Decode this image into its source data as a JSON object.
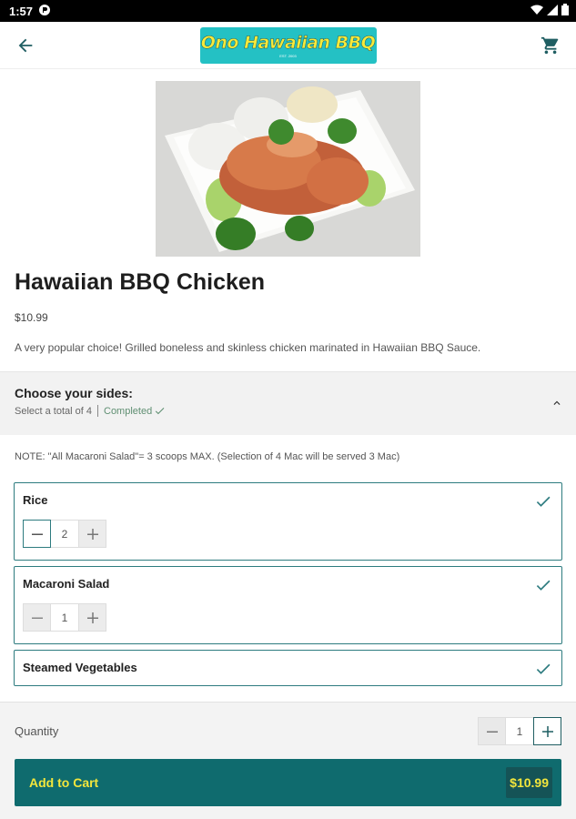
{
  "status_bar": {
    "time": "1:57"
  },
  "header": {
    "logo_text": "Ono Hawaiian BBQ",
    "logo_sub": "EST. 2003"
  },
  "item": {
    "title": "Hawaiian BBQ Chicken",
    "price": "$10.99",
    "description": "A very popular choice! Grilled boneless and skinless chicken marinated in Hawaiian BBQ Sauce."
  },
  "sides": {
    "title": "Choose your sides:",
    "instruction": "Select a total of 4",
    "status": "Completed",
    "note": "NOTE: \"All Macaroni Salad\"= 3 scoops MAX. (Selection of 4 Mac will be served 3 Mac)",
    "options": [
      {
        "name": "Rice",
        "quantity": "2"
      },
      {
        "name": "Macaroni Salad",
        "quantity": "1"
      },
      {
        "name": "Steamed Vegetables",
        "quantity": ""
      }
    ]
  },
  "order": {
    "quantity_label": "Quantity",
    "quantity": "1",
    "add_label": "Add to Cart",
    "total": "$10.99"
  },
  "colors": {
    "brand_teal": "#0f6b6e",
    "accent_yellow": "#f3e63c",
    "logo_bg": "#24c1c4",
    "border_teal": "#2d7b7f"
  }
}
